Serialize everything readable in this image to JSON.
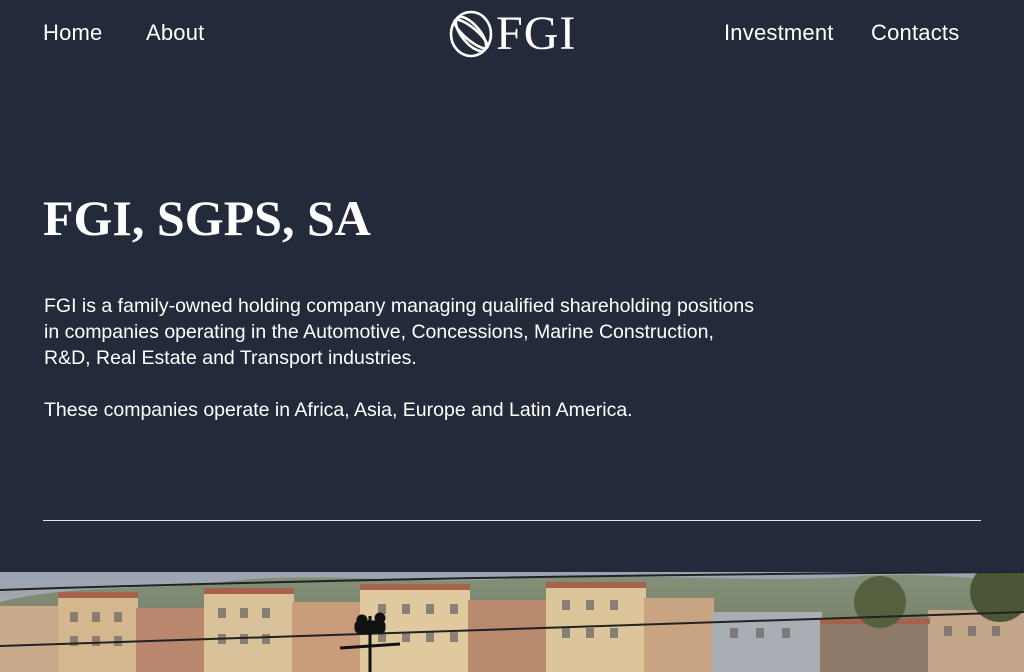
{
  "nav": {
    "home": "Home",
    "about": "About",
    "investment": "Investment",
    "contacts": "Contacts"
  },
  "logo": {
    "text": "FGI",
    "icon": "fgi-logo-mark-icon"
  },
  "main": {
    "title": "FGI, SGPS, SA",
    "paragraph_1": "FGI is a family-owned holding company managing qualified shareholding positions in companies operating in the Automotive, Concessions, Marine Construction, R&D, Real Estate and Transport industries.",
    "paragraph_2": "These companies operate in Africa, Asia, Europe and Latin America."
  },
  "colors": {
    "background": "#232b3a",
    "text": "#ffffff",
    "divider": "#e6e8ec"
  },
  "hero_image": {
    "subject": "city-buildings-with-cable-car-photo"
  }
}
